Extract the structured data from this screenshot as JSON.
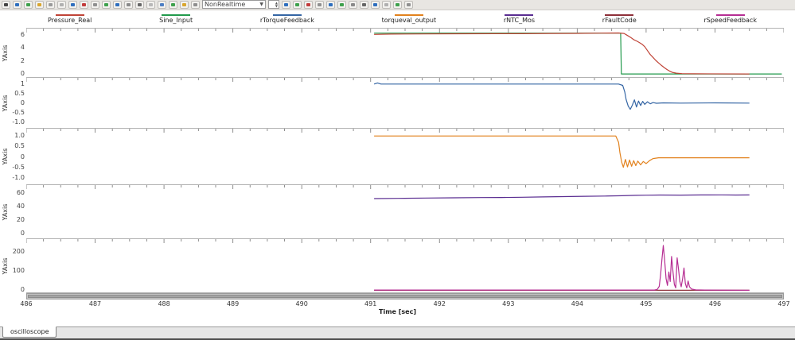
{
  "toolbar": {
    "combo_value": "NonRealtime",
    "left_icons": [
      "#444444",
      "#2f6fbe",
      "#3fa14d",
      "#d9a62e",
      "#9a9a9a",
      "#b0b0b0",
      "#2f6fbe",
      "#c23b3b",
      "#909090",
      "#3fa14d",
      "#2f6fbe",
      "#8a8a8a",
      "#666666",
      "#b8b8b8",
      "#4d7fc4",
      "#3fa14d",
      "#d9a62e",
      "#8f8f8f"
    ],
    "right_icons": [
      "#2f6fbe",
      "#3fa14d",
      "#c23b3b",
      "#909090",
      "#2f6fbe",
      "#3fa14d",
      "#8a8a8a",
      "#666666",
      "#2f6fbe",
      "#b0b0b0",
      "#3fa14d",
      "#909090"
    ]
  },
  "legend": {
    "items": [
      {
        "label": "Pressure_Real",
        "color": "#c04437"
      },
      {
        "label": "Sine_Input",
        "color": "#229a4c"
      },
      {
        "label": "rTorqueFeedback",
        "color": "#3465a4"
      },
      {
        "label": "torqueval_output",
        "color": "#e2821e"
      },
      {
        "label": "rNTC_Mos",
        "color": "#5a2d91"
      },
      {
        "label": "rFaultCode",
        "color": "#8e3039"
      },
      {
        "label": "rSpeedFeedback",
        "color": "#b62e93"
      }
    ]
  },
  "chart_data": {
    "type": "line",
    "xlabel": "Time [sec]",
    "x_range": [
      486,
      497
    ],
    "x_ticks": [
      486,
      487,
      488,
      489,
      490,
      491,
      492,
      493,
      494,
      495,
      496,
      497
    ],
    "panels": [
      {
        "ylabel": "YAxis",
        "ylim": [
          -0.6,
          7.0
        ],
        "yticks": [
          {
            "v": 6,
            "label": "6"
          },
          {
            "v": 4,
            "label": "4"
          },
          {
            "v": 2,
            "label": "2"
          },
          {
            "v": 0,
            "label": "0"
          }
        ],
        "series": [
          {
            "name": "Sine_Input",
            "color": "#229a4c",
            "points": [
              [
                491.05,
                6.3
              ],
              [
                494.63,
                6.3
              ],
              [
                494.64,
                0
              ],
              [
                496.97,
                0
              ]
            ]
          },
          {
            "name": "Pressure_Real",
            "color": "#c04437",
            "points": [
              [
                491.05,
                6.1
              ],
              [
                491.3,
                6.15
              ],
              [
                491.8,
                6.18
              ],
              [
                492.3,
                6.2
              ],
              [
                492.8,
                6.22
              ],
              [
                493.2,
                6.22
              ],
              [
                493.6,
                6.25
              ],
              [
                494.0,
                6.27
              ],
              [
                494.35,
                6.3
              ],
              [
                494.6,
                6.32
              ],
              [
                494.68,
                6.25
              ],
              [
                494.72,
                6.0
              ],
              [
                494.78,
                5.6
              ],
              [
                494.82,
                5.3
              ],
              [
                494.86,
                5.1
              ],
              [
                494.9,
                4.85
              ],
              [
                494.94,
                4.6
              ],
              [
                494.98,
                4.2
              ],
              [
                495.02,
                3.6
              ],
              [
                495.06,
                3.0
              ],
              [
                495.1,
                2.55
              ],
              [
                495.14,
                2.1
              ],
              [
                495.18,
                1.7
              ],
              [
                495.22,
                1.35
              ],
              [
                495.26,
                1.0
              ],
              [
                495.3,
                0.7
              ],
              [
                495.34,
                0.45
              ],
              [
                495.38,
                0.25
              ],
              [
                495.44,
                0.12
              ],
              [
                495.52,
                0.05
              ],
              [
                495.7,
                0.02
              ],
              [
                496.5,
                0.0
              ]
            ]
          }
        ]
      },
      {
        "ylabel": "YAxis",
        "ylim": [
          -1.35,
          1.35
        ],
        "yticks": [
          {
            "v": 1,
            "label": "1"
          },
          {
            "v": 0.5,
            "label": "0.5"
          },
          {
            "v": 0,
            "label": "0"
          },
          {
            "v": -0.5,
            "label": "-0.5"
          },
          {
            "v": -1,
            "label": "-1.0"
          }
        ],
        "series": [
          {
            "name": "rTorqueFeedback",
            "color": "#3465a4",
            "points": [
              [
                491.05,
                1.02
              ],
              [
                491.1,
                1.08
              ],
              [
                491.15,
                1.02
              ],
              [
                492.0,
                1.02
              ],
              [
                493.0,
                1.02
              ],
              [
                494.0,
                1.02
              ],
              [
                494.6,
                1.02
              ],
              [
                494.66,
                0.95
              ],
              [
                494.69,
                0.6
              ],
              [
                494.71,
                0.2
              ],
              [
                494.74,
                -0.15
              ],
              [
                494.77,
                -0.32
              ],
              [
                494.8,
                -0.1
              ],
              [
                494.83,
                0.18
              ],
              [
                494.86,
                -0.2
              ],
              [
                494.89,
                0.12
              ],
              [
                494.92,
                -0.12
              ],
              [
                494.95,
                0.1
              ],
              [
                494.98,
                -0.06
              ],
              [
                495.02,
                0.08
              ],
              [
                495.06,
                -0.03
              ],
              [
                495.1,
                0.04
              ],
              [
                495.15,
                0.0
              ],
              [
                495.25,
                0.02
              ],
              [
                495.5,
                0.01
              ],
              [
                496.0,
                0.02
              ],
              [
                496.5,
                0.01
              ]
            ]
          }
        ]
      },
      {
        "ylabel": "YAxis",
        "ylim": [
          -1.35,
          1.35
        ],
        "yticks": [
          {
            "v": 1,
            "label": "1.0"
          },
          {
            "v": 0.5,
            "label": "0.5"
          },
          {
            "v": 0,
            "label": "0"
          },
          {
            "v": -0.5,
            "label": "-0.5"
          },
          {
            "v": -1,
            "label": "-1.0"
          }
        ],
        "series": [
          {
            "name": "torqueval_output",
            "color": "#e2821e",
            "points": [
              [
                491.05,
                1.0
              ],
              [
                494.56,
                1.0
              ],
              [
                494.6,
                0.7
              ],
              [
                494.62,
                0.2
              ],
              [
                494.645,
                -0.25
              ],
              [
                494.67,
                -0.5
              ],
              [
                494.7,
                -0.12
              ],
              [
                494.73,
                -0.48
              ],
              [
                494.76,
                -0.15
              ],
              [
                494.79,
                -0.45
              ],
              [
                494.82,
                -0.18
              ],
              [
                494.85,
                -0.42
              ],
              [
                494.88,
                -0.2
              ],
              [
                494.92,
                -0.38
              ],
              [
                494.96,
                -0.22
              ],
              [
                495.0,
                -0.32
              ],
              [
                495.05,
                -0.18
              ],
              [
                495.1,
                -0.08
              ],
              [
                495.18,
                -0.04
              ],
              [
                495.4,
                -0.04
              ],
              [
                496.5,
                -0.04
              ]
            ]
          }
        ]
      },
      {
        "ylabel": "YAxis",
        "ylim": [
          -8,
          72
        ],
        "yticks": [
          {
            "v": 60,
            "label": "60"
          },
          {
            "v": 40,
            "label": "40"
          },
          {
            "v": 20,
            "label": "20"
          },
          {
            "v": 0,
            "label": "0"
          }
        ],
        "series": [
          {
            "name": "rNTC_Mos",
            "color": "#5a2d91",
            "points": [
              [
                491.05,
                52.0
              ],
              [
                491.4,
                52.4
              ],
              [
                491.8,
                52.8
              ],
              [
                492.2,
                53.2
              ],
              [
                492.6,
                53.5
              ],
              [
                492.9,
                53.7
              ],
              [
                493.2,
                54.0
              ],
              [
                493.5,
                54.5
              ],
              [
                493.8,
                55.0
              ],
              [
                494.1,
                55.4
              ],
              [
                494.4,
                55.8
              ],
              [
                494.65,
                56.2
              ],
              [
                494.85,
                56.8
              ],
              [
                495.0,
                57.1
              ],
              [
                495.2,
                57.3
              ],
              [
                495.5,
                57.2
              ],
              [
                495.8,
                57.4
              ],
              [
                496.1,
                57.5
              ],
              [
                496.3,
                57.3
              ],
              [
                496.5,
                57.4
              ]
            ]
          }
        ]
      },
      {
        "ylabel": "YAxis",
        "ylim": [
          -15,
          265
        ],
        "yticks": [
          {
            "v": 200,
            "label": "200"
          },
          {
            "v": 100,
            "label": "100"
          },
          {
            "v": 0,
            "label": "0"
          }
        ],
        "series": [
          {
            "name": "rFaultCode",
            "color": "#8e3039",
            "points": [
              [
                491.05,
                0
              ],
              [
                496.5,
                0
              ]
            ]
          },
          {
            "name": "rSpeedFeedback",
            "color": "#b62e93",
            "points": [
              [
                491.05,
                1
              ],
              [
                495.12,
                1
              ],
              [
                495.16,
                4
              ],
              [
                495.19,
                20
              ],
              [
                495.21,
                80
              ],
              [
                495.23,
                160
              ],
              [
                495.25,
                232
              ],
              [
                495.27,
                150
              ],
              [
                495.29,
                60
              ],
              [
                495.31,
                25
              ],
              [
                495.33,
                95
              ],
              [
                495.35,
                45
              ],
              [
                495.37,
                175
              ],
              [
                495.39,
                95
              ],
              [
                495.41,
                30
              ],
              [
                495.43,
                12
              ],
              [
                495.45,
                168
              ],
              [
                495.47,
                110
              ],
              [
                495.49,
                45
              ],
              [
                495.51,
                18
              ],
              [
                495.53,
                60
              ],
              [
                495.55,
                115
              ],
              [
                495.57,
                35
              ],
              [
                495.59,
                12
              ],
              [
                495.61,
                48
              ],
              [
                495.63,
                18
              ],
              [
                495.66,
                6
              ],
              [
                495.72,
                2
              ],
              [
                495.85,
                1
              ],
              [
                496.5,
                0
              ]
            ]
          }
        ]
      }
    ]
  },
  "tabs": [
    {
      "label": "oscilloscope"
    }
  ]
}
